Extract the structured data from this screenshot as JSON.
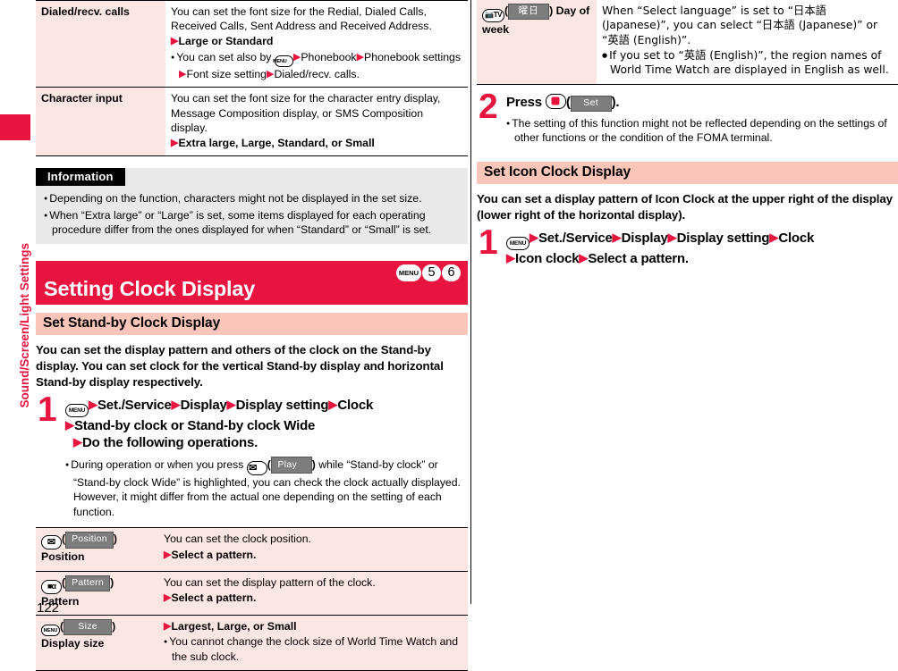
{
  "sidebar": {
    "chapter_label": "Sound/Screen/Light Settings",
    "accent": "#e8133f"
  },
  "page_number": "122",
  "left_column": {
    "font_size_table": {
      "rows": [
        {
          "key_label": "Dialed/recv. calls",
          "desc": "You can set the font size for the Redial, Dialed Calls, Received Calls, Sent Address and Received Address.",
          "option": "Large or Standard",
          "note_prefix": "You can set also by",
          "note_menu_icon": "MENU",
          "note_path_1": "Phonebook",
          "note_path_2": "Phonebook settings",
          "note_path_3": "Font size setting",
          "note_path_4": "Dialed/recv. calls."
        },
        {
          "key_label": "Character input",
          "desc": "You can set the font size for the character entry display, Message Composition display, or SMS Composition display.",
          "option": "Extra large, Large, Standard, or Small"
        }
      ]
    },
    "information": {
      "header": "Information",
      "bullets": [
        "Depending on the function, characters might not be displayed in the set size.",
        "When “Extra large” or “Large” is set, some items displayed for each operating procedure differ from the ones displayed for when “Standard” or “Small” is set."
      ]
    },
    "banner": {
      "title": "Setting Clock Display",
      "keys": [
        "MENU",
        "5",
        "6"
      ]
    },
    "subhead": "Set Stand-by Clock Display",
    "intro": "You can set the display pattern and others of the clock on the Stand-by display. You can set clock for the vertical Stand-by display and horizontal Stand-by display respectively.",
    "step1": {
      "number": "1",
      "menu_icon": "MENU",
      "path": [
        "Set./Service",
        "Display",
        "Display setting",
        "Clock"
      ],
      "path_line2": "Stand-by clock or Stand-by clock Wide",
      "path_line3": "Do the following operations.",
      "note": {
        "part1": "During operation or when you press",
        "mail_icon": "mail-key",
        "softkey": "Play",
        "part2": "while “Stand-by clock” or “Stand-by clock Wide” is highlighted, you can check the clock actually displayed. However, it might differ from the actual one depending on the setting of each function."
      }
    },
    "clock_options_table": {
      "rows": [
        {
          "icon": "mail-key",
          "softkey": "Position",
          "name": "Position",
          "desc": "You can set the clock position.",
          "option": "Select a pattern."
        },
        {
          "icon": "i-appli-key",
          "softkey": "Pattern",
          "name": "Pattern",
          "desc": "You can set the display pattern of the clock.",
          "option": "Select a pattern."
        },
        {
          "icon": "menu-key",
          "softkey": "Size",
          "name": "Display size",
          "option": "Largest, Large, or Small",
          "bullets": [
            "You cannot change the clock size of World Time Watch and the sub clock."
          ]
        }
      ]
    }
  },
  "right_column": {
    "continued_table": {
      "rows": [
        {
          "icon": "camera-tv-key",
          "softkey": "曜日",
          "name": "Day of week",
          "desc": "When “Select language” is set to “日本語 (Japanese)”, you can select “日本語 (Japanese)” or “英語 (English)”.",
          "bullets": [
            "If you set to “英語 (English)”, the region names of World Time Watch are displayed in English as well."
          ]
        }
      ]
    },
    "step2": {
      "number": "2",
      "press_label": "Press",
      "ok_icon": "ok-key",
      "softkey": "Set",
      "tail": ").",
      "note": "The setting of this function might not be reflected depending on the settings of other functions or the condition of the FOMA terminal."
    },
    "subhead": "Set Icon Clock Display",
    "intro": "You can set a display pattern of Icon Clock at the upper right of the display (lower right of the horizontal display).",
    "step1": {
      "number": "1",
      "menu_icon": "MENU",
      "path": [
        "Set./Service",
        "Display",
        "Display setting",
        "Clock"
      ],
      "path_line2_a": "Icon clock",
      "path_line2_b": "Select a pattern."
    }
  }
}
